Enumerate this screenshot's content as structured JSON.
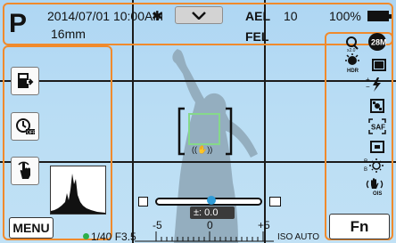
{
  "top_bar": {
    "mode": "P",
    "datetime": "2014/07/01 10:00AM",
    "focal_length": "16mm",
    "bluetooth": "✱",
    "ael": "AEL",
    "fel": "FEL",
    "shots_remaining": "10",
    "battery_percent": "100%"
  },
  "left_panel": {
    "buttons": [
      "save-settings",
      "self-timer-off",
      "touch-shutter"
    ],
    "menu_label": "MENU"
  },
  "right_panel": {
    "icons": [
      "smart-zoom",
      "size-28m",
      "hdr",
      "aspect",
      "flash",
      "metering",
      "af-mode",
      "af-area",
      "white-balance",
      "ois"
    ],
    "af_label": "SAF",
    "size_label": "28M",
    "fn_label": "Fn"
  },
  "bottom": {
    "ev_label": "±: 0.0",
    "scale_left": "-5",
    "scale_mid": "0",
    "scale_right": "+5",
    "shutter_aperture": "1/40 F3.5",
    "iso": "ISO AUTO"
  },
  "colors": {
    "frame_orange": "#f08a2c",
    "af_green": "#86d98a",
    "focus_dot": "#2bb04a",
    "slider_blue": "#2f9bd6"
  }
}
